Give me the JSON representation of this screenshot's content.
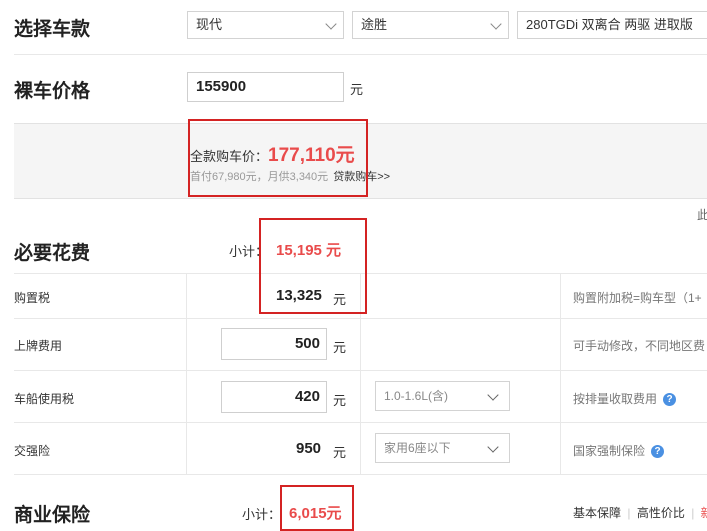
{
  "select_car": {
    "title": "选择车款",
    "brand": "现代",
    "model": "途胜",
    "trim": "280TGDi 双离合 两驱 进取版"
  },
  "base_price": {
    "title": "裸车价格",
    "value": "155900",
    "unit": "元"
  },
  "full_price": {
    "label": "全款购车价：",
    "value": "177,110元",
    "installment_text": "首付67,980元，月供3,340元",
    "loan_link": "贷款购车>>"
  },
  "edge_text": "此",
  "required_fees": {
    "title": "必要花费",
    "subtotal_label": "小计：",
    "subtotal_value": "15,195 元",
    "rows": [
      {
        "label": "购置税",
        "value": "13,325",
        "unit": "元",
        "note": "购置附加税=购车型（1+"
      },
      {
        "label": "上牌费用",
        "value": "500",
        "unit": "元",
        "note": "可手动修改，不同地区费"
      },
      {
        "label": "车船使用税",
        "value": "420",
        "unit": "元",
        "select": "1.0-1.6L(含)",
        "note": "按排量收取费用"
      },
      {
        "label": "交强险",
        "value": "950",
        "unit": "元",
        "select": "家用6座以下",
        "note": "国家强制保险"
      }
    ]
  },
  "commercial_insurance": {
    "title": "商业保险",
    "subtotal_label": "小计：",
    "subtotal_value": "6,015元",
    "tabs": [
      "基本保障",
      "高性价比",
      "新车"
    ]
  },
  "colors": {
    "accent_red": "#e94b4b",
    "box_red": "#d42323",
    "help_blue": "#4a90e2"
  }
}
